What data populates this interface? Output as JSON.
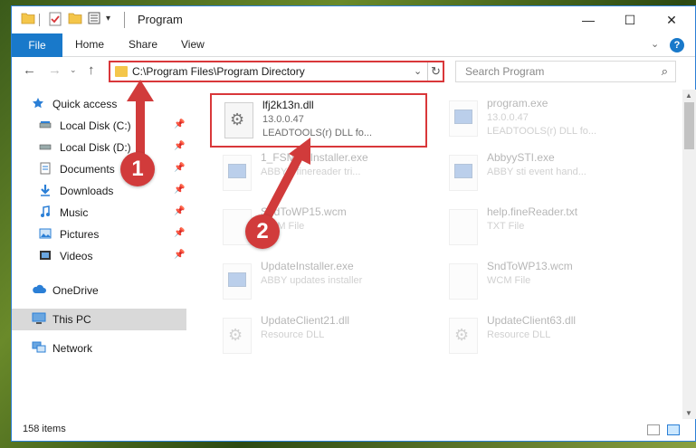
{
  "window": {
    "title": "Program",
    "quick_access_dropdown": "▾",
    "minimize": "—",
    "maximize": "☐",
    "close": "✕"
  },
  "ribbon": {
    "file": "File",
    "home": "Home",
    "share": "Share",
    "view": "View",
    "collapse": "⌄",
    "help": "?"
  },
  "nav": {
    "back": "←",
    "forward": "→",
    "recent": "⌄",
    "up": "↑",
    "address": "C:\\Program Files\\Program Directory",
    "address_dropdown": "⌄",
    "refresh": "↻",
    "search_placeholder": "Search Program",
    "search_icon": "⌕"
  },
  "sidebar": {
    "items": [
      {
        "label": "Quick access",
        "icon": "star-icon"
      },
      {
        "label": "Local Disk (C:)",
        "icon": "drive-icon",
        "pin": "📌"
      },
      {
        "label": "Local Disk (D:)",
        "icon": "drive-icon",
        "pin": "📌"
      },
      {
        "label": "Documents",
        "icon": "documents-icon",
        "pin": "📌"
      },
      {
        "label": "Downloads",
        "icon": "downloads-icon",
        "pin": "📌"
      },
      {
        "label": "Music",
        "icon": "music-icon",
        "pin": "📌"
      },
      {
        "label": "Pictures",
        "icon": "pictures-icon",
        "pin": "📌"
      },
      {
        "label": "Videos",
        "icon": "videos-icon",
        "pin": "📌"
      },
      {
        "label": "OneDrive",
        "icon": "cloud-icon"
      },
      {
        "label": "This PC",
        "icon": "computer-icon"
      },
      {
        "label": "Network",
        "icon": "network-icon"
      }
    ]
  },
  "files": [
    {
      "name": "lfj2k13n.dll",
      "line1": "13.0.0.47",
      "line2": "LEADTOOLS(r) DLL fo...",
      "icon": "dll-gear-icon"
    },
    {
      "name": "program.exe",
      "line1": "13.0.0.47",
      "line2": "LEADTOOLS(r) DLL fo...",
      "icon": "exe-icon"
    },
    {
      "name": "1_FSMmsInstaller.exe",
      "line1": "ABBYY finereader tri...",
      "line2": "",
      "icon": "exe-icon"
    },
    {
      "name": "AbbyySTI.exe",
      "line1": "ABBY sti event hand...",
      "line2": "",
      "icon": "exe-icon"
    },
    {
      "name": "SndToWP15.wcm",
      "line1": "WCM File",
      "line2": "",
      "icon": "file-icon"
    },
    {
      "name": "help.fineReader.txt",
      "line1": "TXT File",
      "line2": "",
      "icon": "file-icon"
    },
    {
      "name": "UpdateInstaller.exe",
      "line1": "ABBY updates installer",
      "line2": "",
      "icon": "exe-icon"
    },
    {
      "name": "SndToWP13.wcm",
      "line1": "WCM File",
      "line2": "",
      "icon": "file-icon"
    },
    {
      "name": "UpdateClient21.dll",
      "line1": "Resource DLL",
      "line2": "",
      "icon": "dll-gear-icon"
    },
    {
      "name": "UpdateClient63.dll",
      "line1": "Resource DLL",
      "line2": "",
      "icon": "dll-gear-icon"
    }
  ],
  "status": {
    "item_count": "158 items"
  },
  "annotations": {
    "step1": "1",
    "step2": "2"
  },
  "colors": {
    "accent": "#1979ca",
    "highlight": "#d9373a",
    "selection": "#cce8ff"
  }
}
